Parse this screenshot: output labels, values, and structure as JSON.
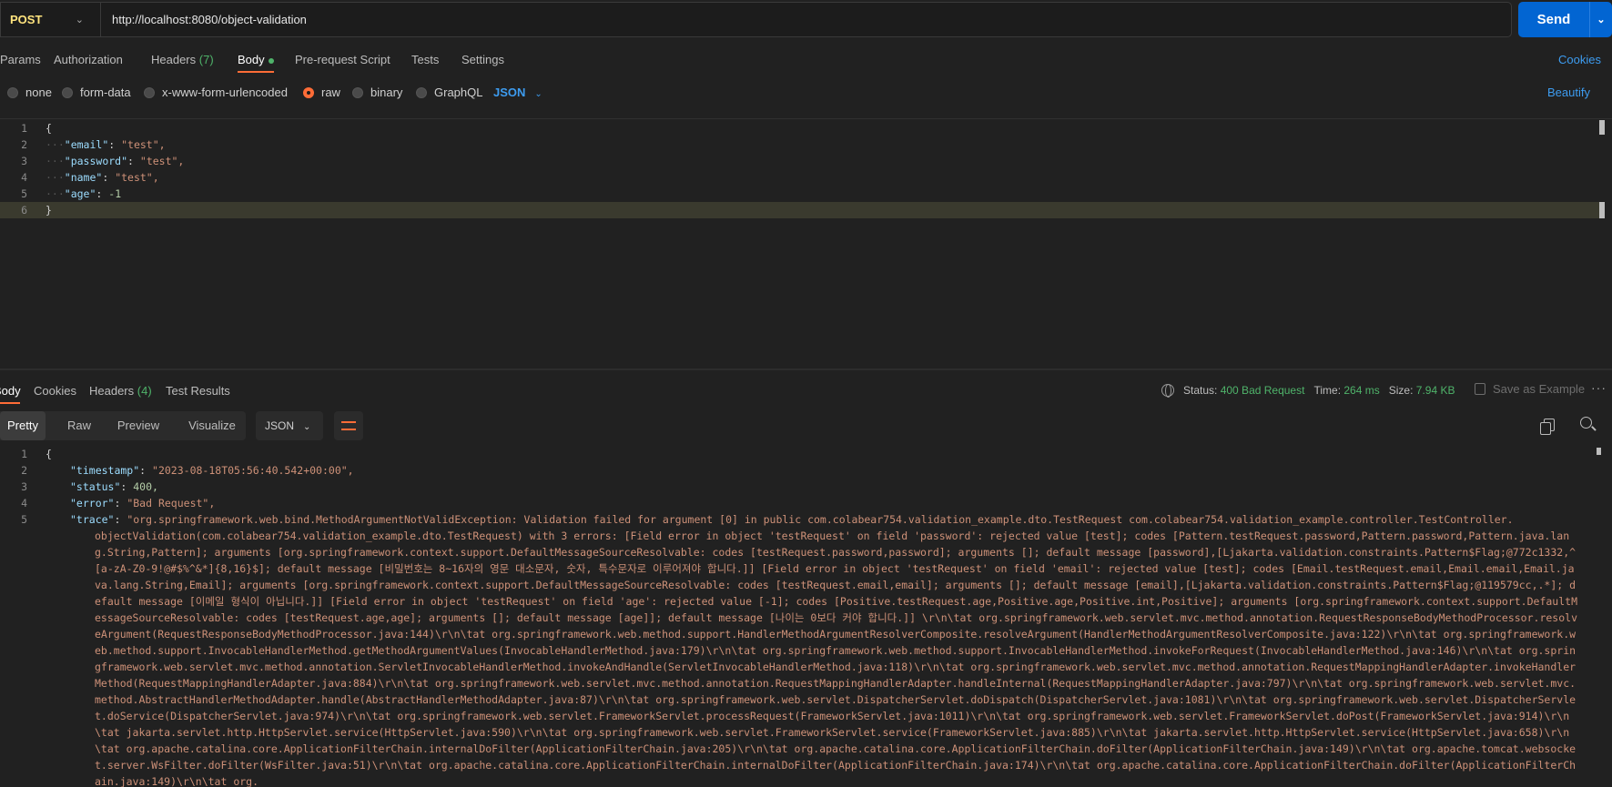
{
  "request": {
    "method": "POST",
    "url": "http://localhost:8080/object-validation",
    "send_label": "Send"
  },
  "req_tabs": {
    "params": "Params",
    "authorization": "Authorization",
    "headers": "Headers",
    "headers_count": "(7)",
    "body": "Body",
    "prerequest": "Pre-request Script",
    "tests": "Tests",
    "settings": "Settings",
    "cookies": "Cookies"
  },
  "body_types": {
    "none": "none",
    "form_data": "form-data",
    "urlencoded": "x-www-form-urlencoded",
    "raw": "raw",
    "binary": "binary",
    "graphql": "GraphQL",
    "format": "JSON",
    "beautify": "Beautify",
    "selected": "raw"
  },
  "editor": {
    "line_numbers": [
      "1",
      "2",
      "3",
      "4",
      "5",
      "6"
    ],
    "open": "{",
    "close": "}",
    "fields": [
      {
        "key": "\"email\"",
        "value": "\"test\",",
        "type": "string"
      },
      {
        "key": "\"password\"",
        "value": "\"test\",",
        "type": "string"
      },
      {
        "key": "\"name\"",
        "value": "\"test\",",
        "type": "string"
      },
      {
        "key": "\"age\"",
        "value": "-1",
        "type": "number"
      }
    ]
  },
  "response": {
    "tabs": {
      "body": "Body",
      "cookies": "Cookies",
      "headers": "Headers",
      "headers_count": "(4)",
      "test_results": "Test Results"
    },
    "status_label": "Status:",
    "status_value": "400 Bad Request",
    "time_label": "Time:",
    "time_value": "264 ms",
    "size_label": "Size:",
    "size_value": "7.94 KB",
    "save_example": "Save as Example",
    "more": "···",
    "views": {
      "pretty": "Pretty",
      "raw": "Raw",
      "preview": "Preview",
      "visualize": "Visualize"
    },
    "format": "JSON",
    "line_numbers": [
      "1",
      "2",
      "3",
      "4",
      "5"
    ],
    "open": "{",
    "timestamp_key": "\"timestamp\"",
    "timestamp_value": "\"2023-08-18T05:56:40.542+00:00\",",
    "status_key": "\"status\"",
    "status_val": "400,",
    "error_key": "\"error\"",
    "error_value": "\"Bad Request\",",
    "trace_key": "\"trace\"",
    "trace_first": "\"org.springframework.web.bind.MethodArgumentNotValidException: Validation failed for argument [0] in public com.colabear754.validation_example.dto.TestRequest com.colabear754.validation_example.controller.TestController.",
    "trace_rest": "objectValidation(com.colabear754.validation_example.dto.TestRequest) with 3 errors: [Field error in object 'testRequest' on field 'password': rejected value [test]; codes [Pattern.testRequest.password,Pattern.password,Pattern.java.lang.String,Pattern]; arguments [org.springframework.context.support.DefaultMessageSourceResolvable: codes [testRequest.password,password]; arguments []; default message [password],[Ljakarta.validation.constraints.Pattern$Flag;@772c1332,^[a-zA-Z0-9!@#$%^&*]{8,16}$]; default message [비밀번호는 8~16자의 영문 대소문자, 숫자, 특수문자로 이루어져야 합니다.]] [Field error in object 'testRequest' on field 'email': rejected value [test]; codes [Email.testRequest.email,Email.email,Email.java.lang.String,Email]; arguments [org.springframework.context.support.DefaultMessageSourceResolvable: codes [testRequest.email,email]; arguments []; default message [email],[Ljakarta.validation.constraints.Pattern$Flag;@119579cc,.*]; default message [이메일 형식이 아닙니다.]] [Field error in object 'testRequest' on field 'age': rejected value [-1]; codes [Positive.testRequest.age,Positive.age,Positive.int,Positive]; arguments [org.springframework.context.support.DefaultMessageSourceResolvable: codes [testRequest.age,age]; arguments []; default message [age]]; default message [나이는 0보다 커야 합니다.]] \\r\\n\\tat org.springframework.web.servlet.mvc.method.annotation.RequestResponseBodyMethodProcessor.resolveArgument(RequestResponseBodyMethodProcessor.java:144)\\r\\n\\tat org.springframework.web.method.support.HandlerMethodArgumentResolverComposite.resolveArgument(HandlerMethodArgumentResolverComposite.java:122)\\r\\n\\tat org.springframework.web.method.support.InvocableHandlerMethod.getMethodArgumentValues(InvocableHandlerMethod.java:179)\\r\\n\\tat org.springframework.web.method.support.InvocableHandlerMethod.invokeForRequest(InvocableHandlerMethod.java:146)\\r\\n\\tat org.springframework.web.servlet.mvc.method.annotation.ServletInvocableHandlerMethod.invokeAndHandle(ServletInvocableHandlerMethod.java:118)\\r\\n\\tat org.springframework.web.servlet.mvc.method.annotation.RequestMappingHandlerAdapter.invokeHandlerMethod(RequestMappingHandlerAdapter.java:884)\\r\\n\\tat org.springframework.web.servlet.mvc.method.annotation.RequestMappingHandlerAdapter.handleInternal(RequestMappingHandlerAdapter.java:797)\\r\\n\\tat org.springframework.web.servlet.mvc.method.AbstractHandlerMethodAdapter.handle(AbstractHandlerMethodAdapter.java:87)\\r\\n\\tat org.springframework.web.servlet.DispatcherServlet.doDispatch(DispatcherServlet.java:1081)\\r\\n\\tat org.springframework.web.servlet.DispatcherServlet.doService(DispatcherServlet.java:974)\\r\\n\\tat org.springframework.web.servlet.FrameworkServlet.processRequest(FrameworkServlet.java:1011)\\r\\n\\tat org.springframework.web.servlet.FrameworkServlet.doPost(FrameworkServlet.java:914)\\r\\n\\tat jakarta.servlet.http.HttpServlet.service(HttpServlet.java:590)\\r\\n\\tat org.springframework.web.servlet.FrameworkServlet.service(FrameworkServlet.java:885)\\r\\n\\tat jakarta.servlet.http.HttpServlet.service(HttpServlet.java:658)\\r\\n\\tat org.apache.catalina.core.ApplicationFilterChain.internalDoFilter(ApplicationFilterChain.java:205)\\r\\n\\tat org.apache.catalina.core.ApplicationFilterChain.doFilter(ApplicationFilterChain.java:149)\\r\\n\\tat org.apache.tomcat.websocket.server.WsFilter.doFilter(WsFilter.java:51)\\r\\n\\tat org.apache.catalina.core.ApplicationFilterChain.internalDoFilter(ApplicationFilterChain.java:174)\\r\\n\\tat org.apache.catalina.core.ApplicationFilterChain.doFilter(ApplicationFilterChain.java:149)\\r\\n\\tat org."
  },
  "colors": {
    "accent": "#ff6c37",
    "link": "#3d9cf0",
    "send": "#0265d2",
    "status_ok": "#4fb36a",
    "method": "#ffe47e"
  }
}
